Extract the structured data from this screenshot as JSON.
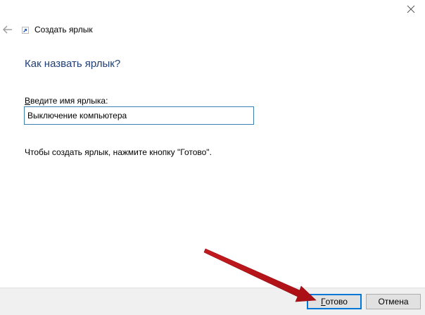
{
  "window": {
    "title": "Создать ярлык"
  },
  "main": {
    "heading": "Как назвать ярлык?",
    "name_label_accel": "В",
    "name_label_rest": "ведите имя ярлыка:",
    "name_value": "Выключение компьютера",
    "hint": "Чтобы создать ярлык, нажмите кнопку \"Готово\"."
  },
  "footer": {
    "finish_accel": "Г",
    "finish_rest": "отово",
    "cancel_label": "Отмена"
  },
  "colors": {
    "heading": "#1e3f78",
    "input_border": "#3c7fb1",
    "default_button_border": "#0078d7",
    "footer_bg": "#f0f0f0",
    "annotation_arrow": "#c0161b"
  },
  "icons": [
    "close-icon",
    "back-arrow-icon",
    "shortcut-icon",
    "annotation-arrow"
  ]
}
